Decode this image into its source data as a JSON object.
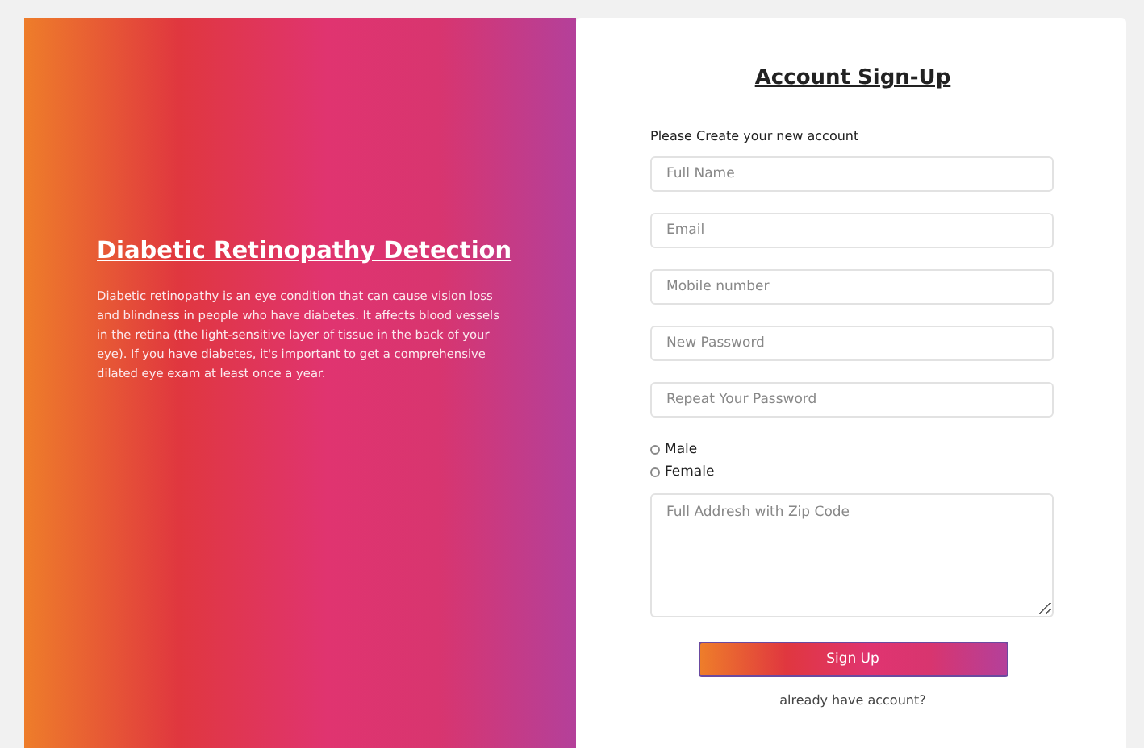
{
  "info": {
    "title": "Diabetic Retinopathy Detection",
    "text": "Diabetic retinopathy is an eye condition that can cause vision loss and blindness in people who have diabetes. It affects blood vessels in the retina (the light-sensitive layer of tissue in the back of your eye). If you have diabetes, it's important to get a comprehensive dilated eye exam at least once a year."
  },
  "form": {
    "title": "Account Sign-Up",
    "subtitle": "Please Create your new account",
    "fields": [
      {
        "placeholder": "Full Name"
      },
      {
        "placeholder": "Email"
      },
      {
        "placeholder": "Mobile number"
      },
      {
        "placeholder": "New Password"
      },
      {
        "placeholder": "Repeat Your Password"
      }
    ],
    "gender": [
      {
        "label": "Male",
        "selected": false
      },
      {
        "label": "Female",
        "selected": false
      }
    ],
    "address": {
      "placeholder": "Full Addresh with Zip Code"
    },
    "submit": "Sign Up",
    "login_link": "already have account?"
  }
}
